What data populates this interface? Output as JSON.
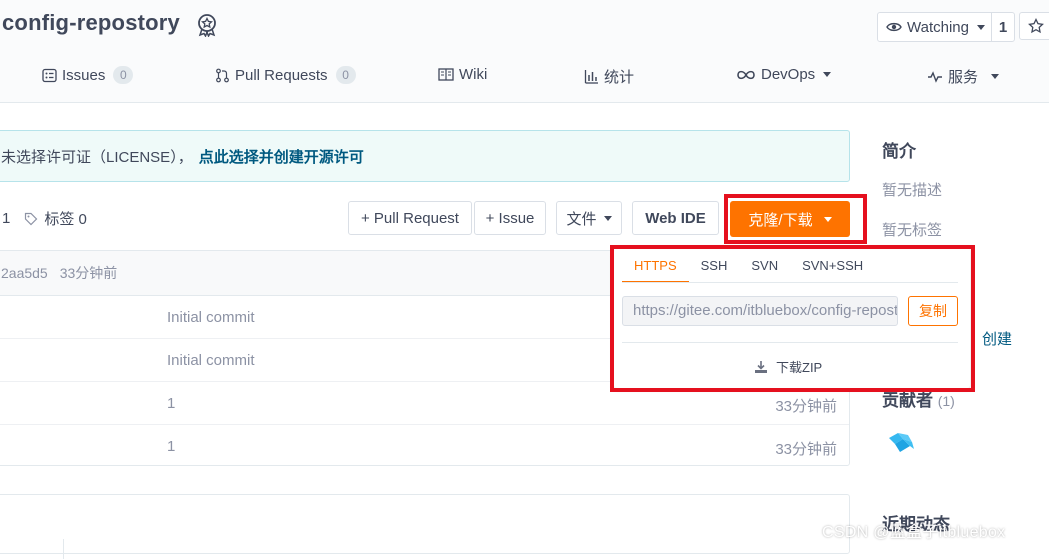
{
  "repo": {
    "name": "config-repostory"
  },
  "watch": {
    "label": "Watching",
    "count": "1"
  },
  "nav": {
    "issues": {
      "label": "Issues",
      "count": "0"
    },
    "pulls": {
      "label": "Pull Requests",
      "count": "0"
    },
    "wiki": {
      "label": "Wiki"
    },
    "stats": {
      "label": "统计"
    },
    "devops": {
      "label": "DevOps"
    },
    "services": {
      "label": "服务"
    }
  },
  "license": {
    "text": "未选择许可证（LICENSE），",
    "link": "点此选择并创建开源许可"
  },
  "branch": {
    "count_tail": "1",
    "tags_label": "标签 0"
  },
  "toolbar": {
    "pull_request": "+ Pull Request",
    "issue": "+ Issue",
    "file": "文件",
    "web_ide": "Web IDE",
    "clone": "克隆/下载"
  },
  "commit": {
    "hash": "2aa5d5",
    "time": "33分钟前"
  },
  "files": [
    {
      "message": "Initial commit",
      "time": ""
    },
    {
      "message": "Initial commit",
      "time": ""
    },
    {
      "message": "1",
      "time": "33分钟前"
    },
    {
      "message": "1",
      "time": "33分钟前"
    }
  ],
  "sidebar": {
    "intro_title": "简介",
    "no_desc": "暂无描述",
    "no_tags": "暂无标签",
    "create_link": "创建",
    "contributors_title": "贡献者",
    "contributors_count": "(1)",
    "recent_title": "近期动态"
  },
  "clone_dropdown": {
    "tabs": [
      "HTTPS",
      "SSH",
      "SVN",
      "SVN+SSH"
    ],
    "active_tab": "HTTPS",
    "url": "https://gitee.com/itbluebox/config-repostory.git",
    "copy_label": "复制",
    "zip_label": "下载ZIP"
  },
  "watermark": "CSDN @蓝盒子itbluebox",
  "colors": {
    "accent": "#fe7300",
    "highlight_box": "#e5101e",
    "link": "#005980"
  }
}
